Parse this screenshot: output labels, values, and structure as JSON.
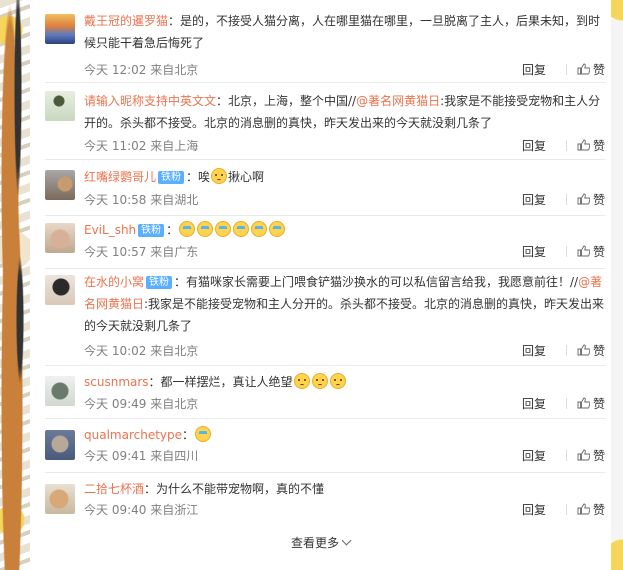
{
  "ui": {
    "reply_label": "回复",
    "like_label": "赞",
    "load_more": "查看更多"
  },
  "comments": [
    {
      "user": "戴王冠的暹罗猫",
      "text": "：是的，不接受人猫分离，人在哪里猫在哪里，一旦脱离了主人，后果未知，到时候只能干着急后悔死了",
      "meta": "今天 12:02 来自北京"
    },
    {
      "user": "请输入昵称支持中英文文",
      "text_a": "：北京，上海，整个中国//",
      "mention": "@著名网黄猫日",
      "text_b": ":我家是不能接受宠物和主人分开的。杀头都不接受。北京的消息删的真快，昨天发出来的今天就没剩几条了",
      "meta": "今天 11:02 来自上海"
    },
    {
      "user": "红嘴绿鹦哥儿",
      "badge": "铁粉",
      "text_a": "：唉",
      "text_b": "揪心啊",
      "meta": "今天 10:58 来自湖北"
    },
    {
      "user": "EviL_shh",
      "badge": "铁粉",
      "text": "：",
      "meta": "今天 10:57 来自广东"
    },
    {
      "user": "在水的小窝",
      "badge": "铁粉",
      "text_a": "：有猫咪家长需要上门喂食铲猫沙换水的可以私信留言给我，我愿意前往！//",
      "mention": "@著名网黄猫日",
      "text_b": ":我家是不能接受宠物和主人分开的。杀头都不接受。北京的消息删的真快，昨天发出来的今天就没剩几条了",
      "meta": "今天 10:02 来自北京"
    },
    {
      "user": "scusnmars",
      "text": "：都一样摆烂，真让人绝望",
      "meta": "今天 09:49 来自北京"
    },
    {
      "user": "qualmarchetype",
      "text": "：",
      "meta": "今天 09:41 来自四川"
    },
    {
      "user": "二拾七杯酒",
      "text": "：为什么不能带宠物啊，真的不懂",
      "meta": "今天 09:40 来自浙江"
    }
  ]
}
